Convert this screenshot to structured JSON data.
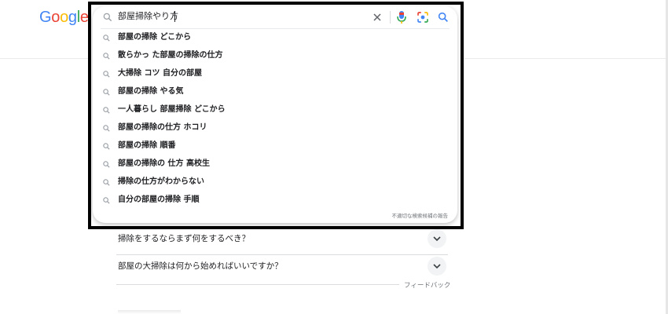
{
  "logo": {
    "text": [
      "G",
      "o",
      "o",
      "g",
      "l",
      "e"
    ],
    "colors": [
      "#4285F4",
      "#EA4335",
      "#FBBC05",
      "#4285F4",
      "#34A853",
      "#EA4335"
    ]
  },
  "search": {
    "query": "部屋掃除やり方"
  },
  "suggestions": [
    "部屋の掃除 どこから",
    "散らかっ た部屋の掃除の仕方",
    "大掃除 コツ 自分の部屋",
    "部屋の掃除 やる気",
    "一人暮らし 部屋掃除 どこから",
    "部屋の掃除の仕方 ホコリ",
    "部屋の掃除 順番",
    "部屋の掃除の 仕方 高校生",
    "掃除の仕方がわからない",
    "自分の部屋の掃除 手順"
  ],
  "report_label": "不適切な検索候補の報告",
  "related_questions": [
    "掃除をするならまず何をするべき？",
    "部屋の大掃除は何から始めればいいですか？"
  ],
  "feedback_label": "フィードバック",
  "icons": {
    "search": "search-icon",
    "clear": "close-icon",
    "mic": "microphone-icon",
    "lens": "lens-icon",
    "chevron": "chevron-down-icon"
  },
  "colors": {
    "frame": "#000000",
    "accent_blue": "#4285F4",
    "text": "#202124",
    "muted": "#70757a"
  }
}
